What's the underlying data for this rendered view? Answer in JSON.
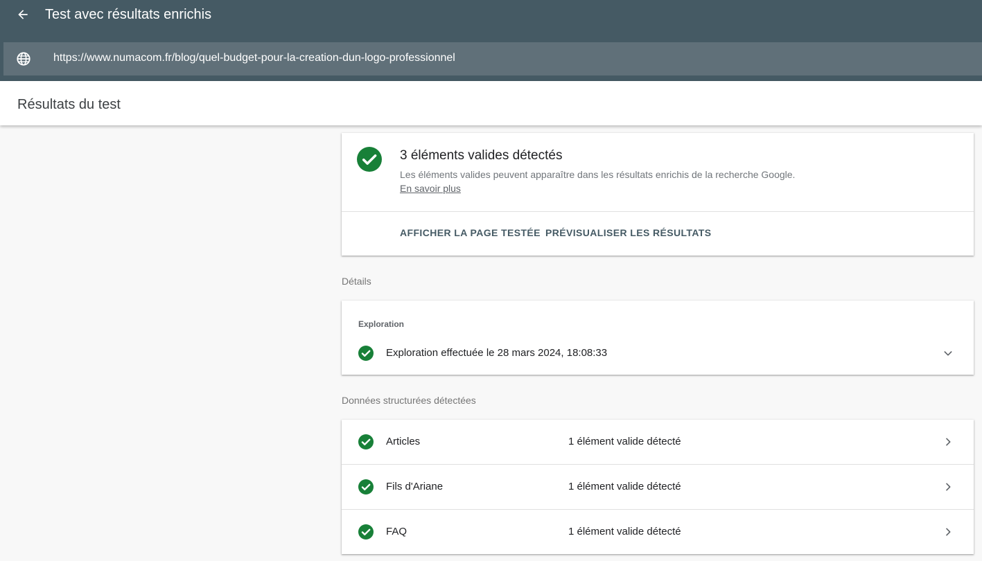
{
  "header": {
    "title": "Test avec résultats enrichis",
    "url": "https://www.numacom.fr/blog/quel-budget-pour-la-creation-dun-logo-professionnel"
  },
  "results": {
    "title": "Résultats du test"
  },
  "summary": {
    "title": "3 éléments valides détectés",
    "description": "Les éléments valides peuvent apparaître dans les résultats enrichis de la recherche Google.",
    "learn_more": "En savoir plus",
    "view_page_button": "AFFICHER LA PAGE TESTÉE",
    "preview_button": "PRÉVISUALISER LES RÉSULTATS"
  },
  "details": {
    "label": "Détails",
    "crawl_label": "Exploration",
    "crawl_status": "Exploration effectuée le 28 mars 2024, 18:08:33"
  },
  "structured": {
    "label": "Données structurées détectées",
    "items": [
      {
        "name": "Articles",
        "status": "1 élément valide détecté"
      },
      {
        "name": "Fils d'Ariane",
        "status": "1 élément valide détecté"
      },
      {
        "name": "FAQ",
        "status": "1 élément valide détecté"
      }
    ]
  },
  "colors": {
    "header_bg": "#455a64",
    "url_bar_bg": "#607079",
    "valid_green": "#188038",
    "button_text": "#455a64"
  },
  "icons": {
    "back": "arrow-left-icon",
    "globe": "globe-icon",
    "valid": "check-circle-icon",
    "expand": "chevron-down-icon",
    "open": "chevron-right-icon"
  }
}
